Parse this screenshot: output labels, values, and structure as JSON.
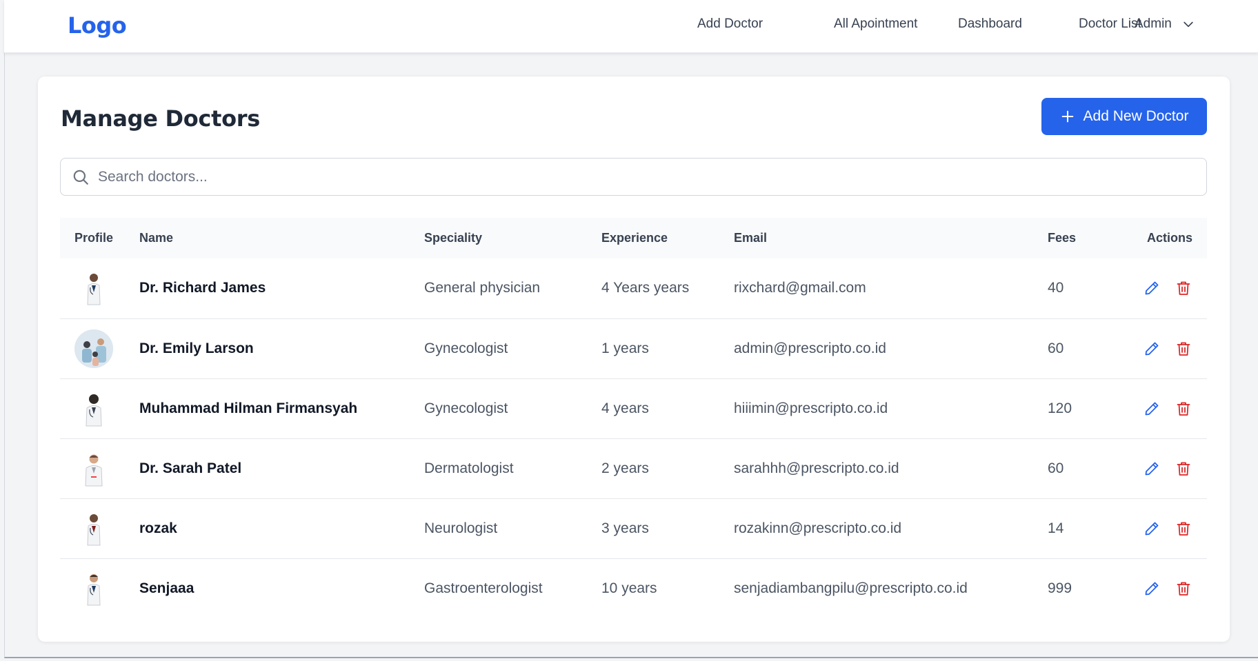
{
  "navbar": {
    "logo": "Logo",
    "links": [
      "Add Doctor",
      "All Apointment",
      "Dashboard",
      "Doctor List"
    ],
    "admin_label": "Admin"
  },
  "main": {
    "title": "Manage Doctors",
    "add_button_label": "Add New Doctor",
    "search_placeholder": "Search doctors...",
    "table": {
      "headers": [
        "Profile",
        "Name",
        "Speciality",
        "Experience",
        "Email",
        "Fees",
        "Actions"
      ],
      "rows": [
        {
          "name": "Dr. Richard James",
          "speciality": "General physician",
          "experience": "4 Years years",
          "email": "rixchard@gmail.com",
          "fees": "40",
          "avatar": "doctor-portrait-small"
        },
        {
          "name": "Dr. Emily Larson",
          "speciality": "Gynecologist",
          "experience": "1 years",
          "email": "admin@prescripto.co.id",
          "fees": "60",
          "avatar": "clinic-photo-round"
        },
        {
          "name": "Muhammad Hilman Firmansyah",
          "speciality": "Gynecologist",
          "experience": "4 years",
          "email": "hiiimin@prescripto.co.id",
          "fees": "120",
          "avatar": "doctor-portrait-small"
        },
        {
          "name": "Dr. Sarah Patel",
          "speciality": "Dermatologist",
          "experience": "2 years",
          "email": "sarahhh@prescripto.co.id",
          "fees": "60",
          "avatar": "doctor-portrait-small"
        },
        {
          "name": "rozak",
          "speciality": "Neurologist",
          "experience": "3 years",
          "email": "rozakinn@prescripto.co.id",
          "fees": "14",
          "avatar": "doctor-portrait-small"
        },
        {
          "name": "Senjaaa",
          "speciality": "Gastroenterologist",
          "experience": "10 years",
          "email": "senjadiambangpilu@prescripto.co.id",
          "fees": "999",
          "avatar": "doctor-portrait-small"
        }
      ]
    }
  },
  "colors": {
    "accent": "#2563eb",
    "delete": "#dc2626",
    "edit": "#2563eb",
    "background": "#f3f4f6",
    "header_row": "#f9fafb"
  },
  "icons": {
    "dropdown": "chevron-down-icon",
    "add": "plus-icon",
    "search": "search-icon",
    "edit": "pencil-icon",
    "delete": "trash-icon"
  }
}
